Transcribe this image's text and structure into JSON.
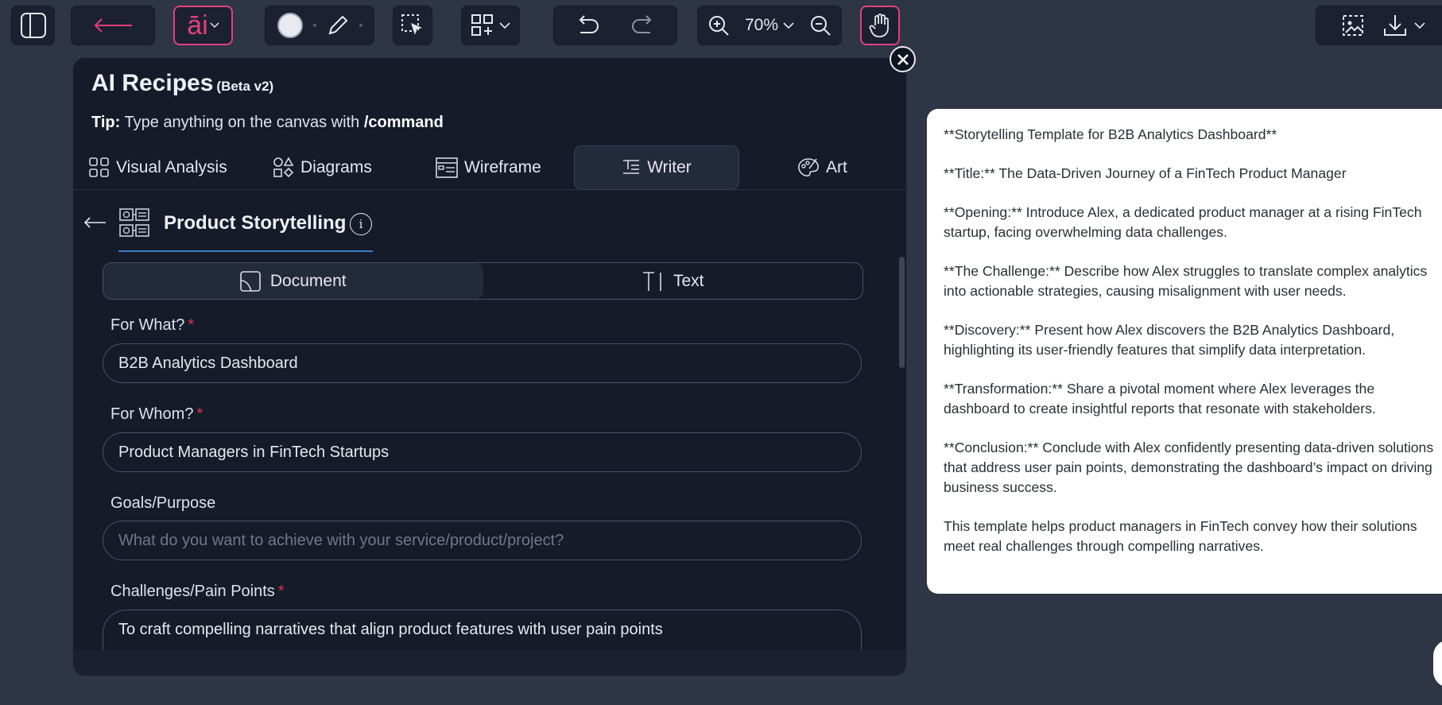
{
  "toolbar": {
    "zoom_level": "70%"
  },
  "panel": {
    "title": "AI Recipes",
    "badge": "(Beta v2)",
    "tip_label": "Tip:",
    "tip_text": "Type anything on the canvas with",
    "tip_command": "/command",
    "categories": [
      {
        "label": "Visual Analysis",
        "icon": "grid-icon"
      },
      {
        "label": "Diagrams",
        "icon": "shapes-icon"
      },
      {
        "label": "Wireframe",
        "icon": "wireframe-icon"
      },
      {
        "label": "Writer",
        "icon": "writer-icon",
        "active": true
      },
      {
        "label": "Art",
        "icon": "palette-icon"
      }
    ],
    "recipe_name": "Product Storytelling",
    "modes": [
      {
        "label": "Document",
        "active": true
      },
      {
        "label": "Text",
        "active": false
      }
    ],
    "fields": {
      "for_what": {
        "label": "For What?",
        "value": "B2B Analytics Dashboard",
        "required": "*"
      },
      "for_whom": {
        "label": "For Whom?",
        "value": "Product Managers in FinTech Startups",
        "required": "*"
      },
      "goals": {
        "label": "Goals/Purpose",
        "placeholder": "What do you want to achieve with your service/product/project?"
      },
      "challenges": {
        "label": "Challenges/Pain Points",
        "value": "To craft compelling narratives that align product features with user pain points",
        "required": "*"
      }
    }
  },
  "output": {
    "paragraphs": [
      "**Storytelling Template for B2B Analytics Dashboard**",
      "**Title:** The Data-Driven Journey of a FinTech Product Manager",
      "**Opening:** Introduce Alex, a dedicated product manager at a rising FinTech startup, facing overwhelming data challenges.",
      "**The Challenge:** Describe how Alex struggles to translate complex analytics into actionable strategies, causing misalignment with user needs.",
      "**Discovery:** Present how Alex discovers the B2B Analytics Dashboard, highlighting its user-friendly features that simplify data interpretation.",
      "**Transformation:** Share a pivotal moment where Alex leverages the dashboard to create insightful reports that resonate with stakeholders.",
      "**Conclusion:** Conclude with Alex confidently presenting data-driven solutions that address user pain points, demonstrating the dashboard’s impact on driving business success.",
      "This template helps product managers in FinTech convey how their solutions meet real challenges through compelling narratives."
    ]
  },
  "colors": {
    "background": "#2e3545",
    "panel": "#151b29",
    "accent_pink": "#e0407a",
    "accent_blue": "#3d7ac7",
    "required": "#e0304d"
  }
}
